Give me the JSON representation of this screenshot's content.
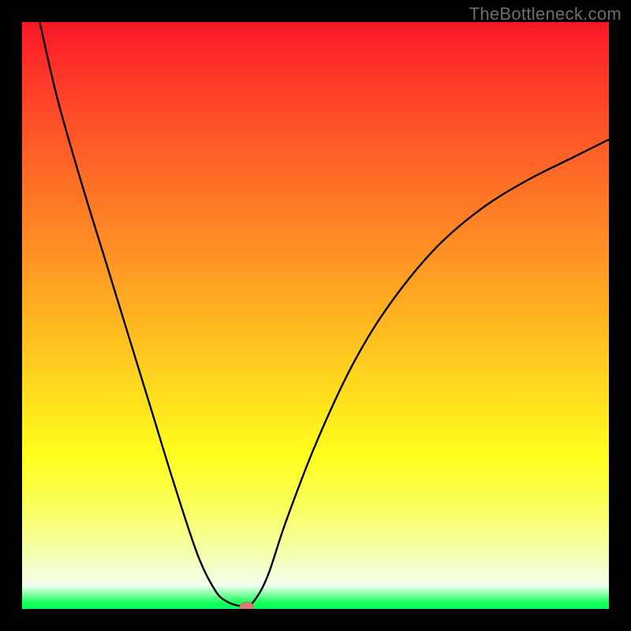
{
  "watermark": "TheBottleneck.com",
  "chart_data": {
    "type": "line",
    "title": "",
    "xlabel": "",
    "ylabel": "",
    "xlim": [
      0,
      100
    ],
    "ylim": [
      0,
      100
    ],
    "grid": false,
    "legend": false,
    "series": [
      {
        "name": "curve",
        "x": [
          3,
          6,
          10,
          14,
          18,
          22,
          26,
          30,
          33,
          35,
          37,
          38.3,
          40,
          42,
          45,
          50,
          56,
          62,
          70,
          78,
          86,
          94,
          100
        ],
        "y": [
          100,
          87,
          73,
          60,
          47,
          34,
          21,
          9,
          3,
          1.2,
          0.5,
          0.3,
          2,
          6,
          15,
          28,
          41,
          51,
          61,
          68,
          73,
          77,
          80
        ]
      }
    ],
    "marker": {
      "x": 38.3,
      "y": 0.3,
      "color": "#d87d75"
    },
    "background": "rainbow-gradient"
  }
}
